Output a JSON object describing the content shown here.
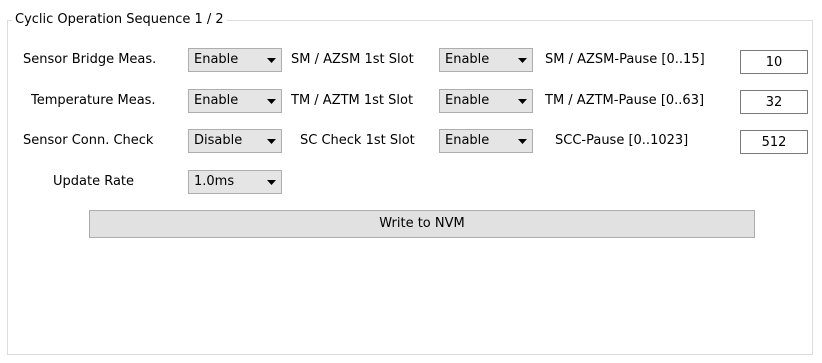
{
  "group": {
    "title": "Cyclic Operation Sequence 1 / 2"
  },
  "rows": [
    {
      "label": "Sensor Bridge Meas.",
      "mode": "Enable",
      "slot_label": "SM / AZSM 1st Slot",
      "slot_value": "Enable",
      "pause_label": "SM / AZSM-Pause [0..15]",
      "pause_value": "10"
    },
    {
      "label": "Temperature Meas.",
      "mode": "Enable",
      "slot_label": "TM / AZTM 1st Slot",
      "slot_value": "Enable",
      "pause_label": "TM / AZTM-Pause [0..63]",
      "pause_value": "32"
    },
    {
      "label": "Sensor Conn. Check",
      "mode": "Disable",
      "slot_label": "SC Check 1st Slot",
      "slot_value": "Enable",
      "pause_label": "SCC-Pause [0..1023]",
      "pause_value": "512"
    }
  ],
  "update_rate": {
    "label": "Update Rate",
    "value": "1.0ms"
  },
  "write_button": {
    "label": "Write to NVM"
  },
  "icons": {
    "dropdown": "chevron-down-icon"
  }
}
